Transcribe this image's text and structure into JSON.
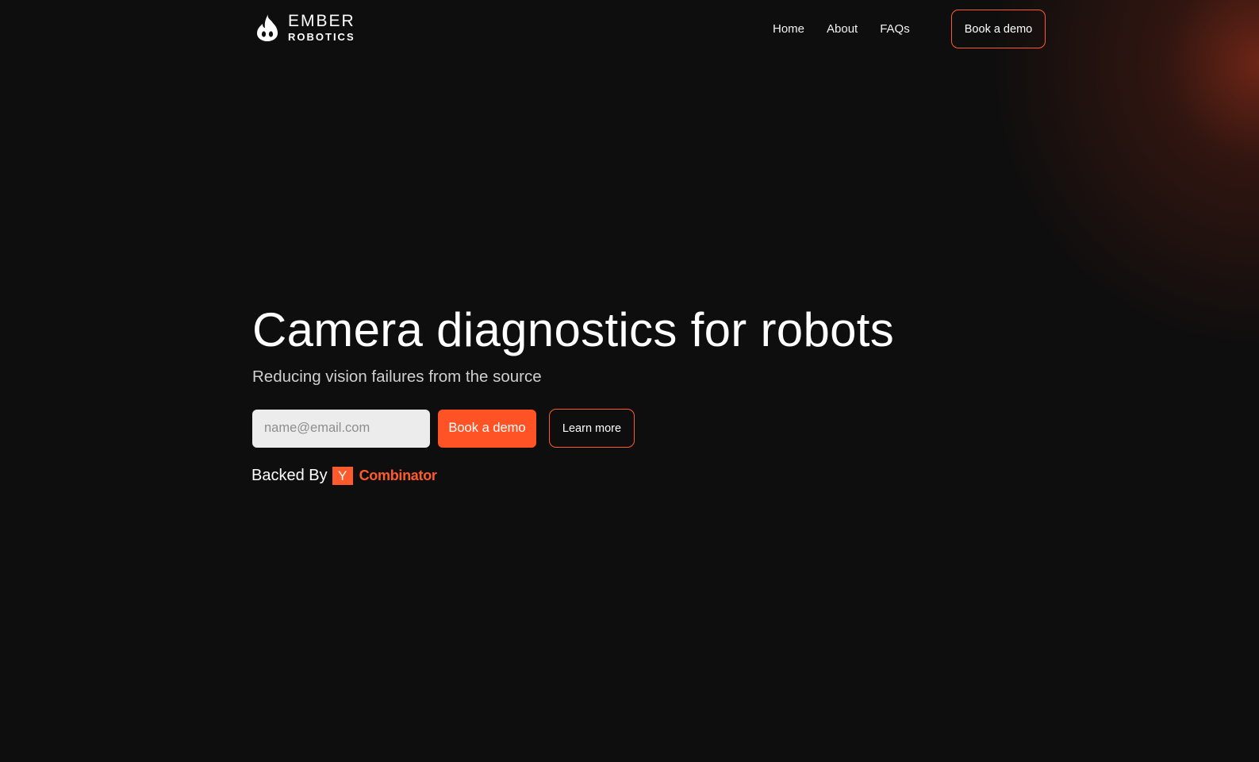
{
  "brand": {
    "name_line1": "EMBER",
    "name_line2": "ROBOTICS",
    "logo_icon": "flame-robot-icon"
  },
  "nav": {
    "items": [
      {
        "label": "Home"
      },
      {
        "label": "About"
      },
      {
        "label": "FAQs"
      }
    ],
    "cta_label": "Book a demo"
  },
  "hero": {
    "title": "Camera diagnostics for robots",
    "subtitle": "Reducing vision failures from the source",
    "email_placeholder": "name@email.com",
    "primary_cta": "Book a demo",
    "secondary_cta": "Learn more"
  },
  "backed": {
    "label": "Backed By",
    "yc_letter": "Y",
    "yc_word": "Combinator"
  },
  "colors": {
    "background": "#0e0e0e",
    "accent": "#ff5326",
    "glow": "#8c2d19"
  }
}
